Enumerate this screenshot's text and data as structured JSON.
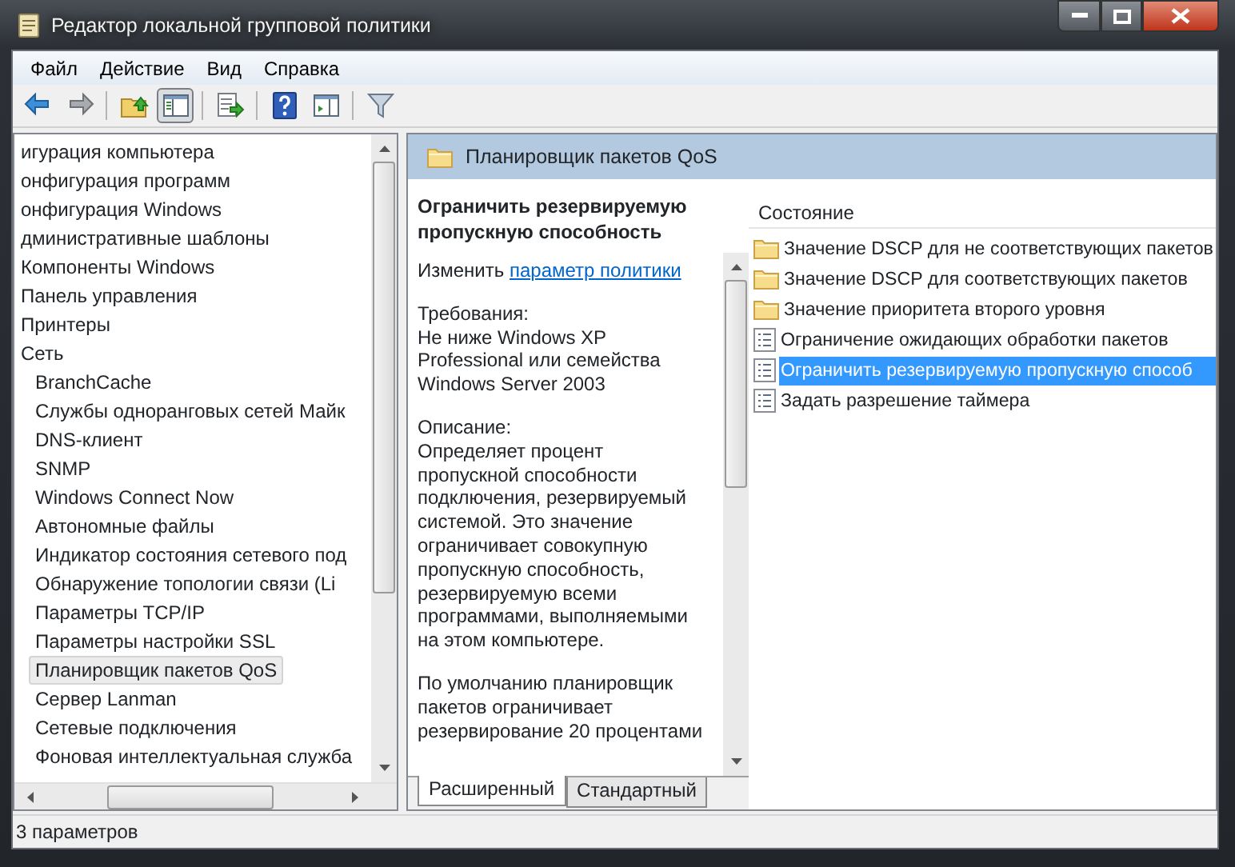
{
  "window": {
    "title": "Редактор локальной групповой политики"
  },
  "menu": [
    "Файл",
    "Действие",
    "Вид",
    "Справка"
  ],
  "toolbar": [
    {
      "kind": "back",
      "pressed": false
    },
    {
      "kind": "forward",
      "pressed": false
    },
    {
      "kind": "separator"
    },
    {
      "kind": "up",
      "pressed": false
    },
    {
      "kind": "tree",
      "pressed": true
    },
    {
      "kind": "separator"
    },
    {
      "kind": "export",
      "pressed": false
    },
    {
      "kind": "separator"
    },
    {
      "kind": "help",
      "pressed": false
    },
    {
      "kind": "pane",
      "pressed": false
    },
    {
      "kind": "separator"
    },
    {
      "kind": "filter",
      "pressed": false
    }
  ],
  "tree": [
    {
      "label": "игурация компьютера",
      "selected": false,
      "children": [
        {
          "label": "онфигурация программ",
          "selected": false
        },
        {
          "label": "онфигурация Windows",
          "selected": false
        },
        {
          "label": "дминистративные шаблоны",
          "selected": false,
          "children": [
            {
              "label": "Компоненты Windows",
              "selected": false
            },
            {
              "label": "Панель управления",
              "selected": false
            },
            {
              "label": "Принтеры",
              "selected": false
            },
            {
              "label": "Сеть",
              "selected": false,
              "children": [
                {
                  "label": "BranchCache",
                  "selected": false
                },
                {
                  "label": "Службы одноранговых сетей Майк",
                  "selected": false
                },
                {
                  "label": "DNS-клиент",
                  "selected": false
                },
                {
                  "label": "SNMP",
                  "selected": false
                },
                {
                  "label": "Windows Connect Now",
                  "selected": false
                },
                {
                  "label": "Автономные файлы",
                  "selected": false
                },
                {
                  "label": "Индикатор состояния сетевого под",
                  "selected": false
                },
                {
                  "label": "Обнаружение топологии связи (Li",
                  "selected": false
                },
                {
                  "label": "Параметры TCP/IP",
                  "selected": false
                },
                {
                  "label": "Параметры настройки SSL",
                  "selected": false
                },
                {
                  "label": "Планировщик пакетов QoS",
                  "selected": true
                },
                {
                  "label": "Сервер Lanman",
                  "selected": false
                },
                {
                  "label": "Сетевые подключения",
                  "selected": false
                },
                {
                  "label": "Фоновая интеллектуальная служба",
                  "selected": false
                }
              ]
            }
          ]
        }
      ]
    }
  ],
  "detail": {
    "header": "Планировщик пакетов QoS",
    "title": "Ограничить резервируемую\nпропускную способность",
    "blocks": [
      {
        "kind": "edit",
        "text": "Изменить",
        "link": "параметр политики"
      },
      {
        "kind": "text",
        "text": "Требования:\nНе ниже Windows XP\nProfessional или семейства\nWindows Server 2003"
      },
      {
        "kind": "text",
        "text": "Описание:\nОпределяет процент\nпропускной способности\nподключения, резервируемый\nсистемой. Это значение\nограничивает совокупную\nпропускную способность,\nрезервируемую всеми\nпрограммами, выполняемыми\nна этом компьютере."
      },
      {
        "kind": "text",
        "text": "По умолчанию планировщик\nпакетов ограничивает\nрезервирование 20 процентами"
      }
    ],
    "tabs": [
      {
        "label": "Расширенный",
        "selected": true
      },
      {
        "label": "Стандартный",
        "selected": false
      }
    ]
  },
  "list": {
    "column": "Состояние",
    "rows": [
      {
        "label": "Значение DSCP для не соответствующих пакетов",
        "kind": "folder",
        "selected": false
      },
      {
        "label": "Значение DSCP для соответствующих пакетов",
        "kind": "folder",
        "selected": false
      },
      {
        "label": "Значение приоритета второго уровня",
        "kind": "folder",
        "selected": false
      },
      {
        "label": "Ограничение ожидающих обработки пакетов",
        "kind": "setting",
        "selected": false
      },
      {
        "label": "Ограничить резервируемую пропускную способ",
        "kind": "setting",
        "selected": true
      },
      {
        "label": "Задать разрешение таймера",
        "kind": "setting",
        "selected": false
      }
    ]
  },
  "status_bar": "3 параметров"
}
